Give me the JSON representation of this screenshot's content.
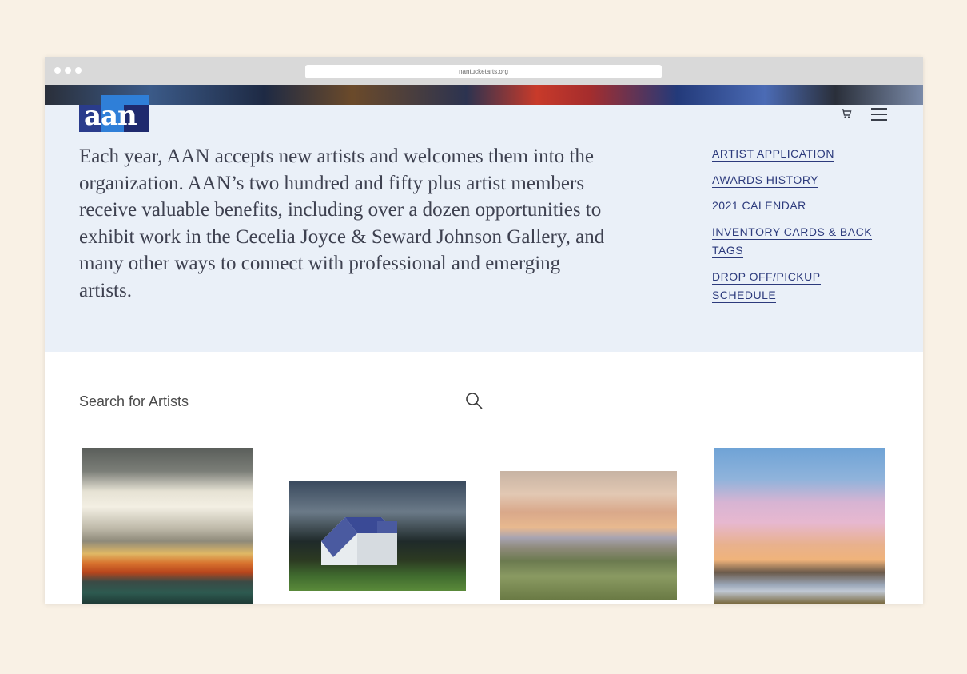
{
  "browser": {
    "url": "nantucketarts.org"
  },
  "logo": {
    "text": "aan"
  },
  "header": {
    "cart_icon": "cart-icon",
    "menu_icon": "hamburger-menu-icon"
  },
  "intro": {
    "text": "Each year, AAN accepts new artists and welcomes them into the organization. AAN’s two hundred and fifty plus artist members receive valuable benefits, including over a dozen opportunities to exhibit work in the Cecelia Joyce & Seward Johnson Gallery, and many other ways to connect with professional and emerging artists."
  },
  "sidebar_links": [
    {
      "label": "ARTIST APPLICATION"
    },
    {
      "label": "AWARDS HISTORY"
    },
    {
      "label": "2021 CALENDAR"
    },
    {
      "label": "INVENTORY CARDS & BACK TAGS"
    },
    {
      "label": "DROP OFF/PICKUP SCHEDULE"
    }
  ],
  "search": {
    "placeholder": "Search for Artists",
    "icon": "search-icon"
  },
  "gallery": [
    {
      "name": "artwork-1"
    },
    {
      "name": "artwork-2"
    },
    {
      "name": "artwork-3"
    },
    {
      "name": "artwork-4"
    }
  ]
}
